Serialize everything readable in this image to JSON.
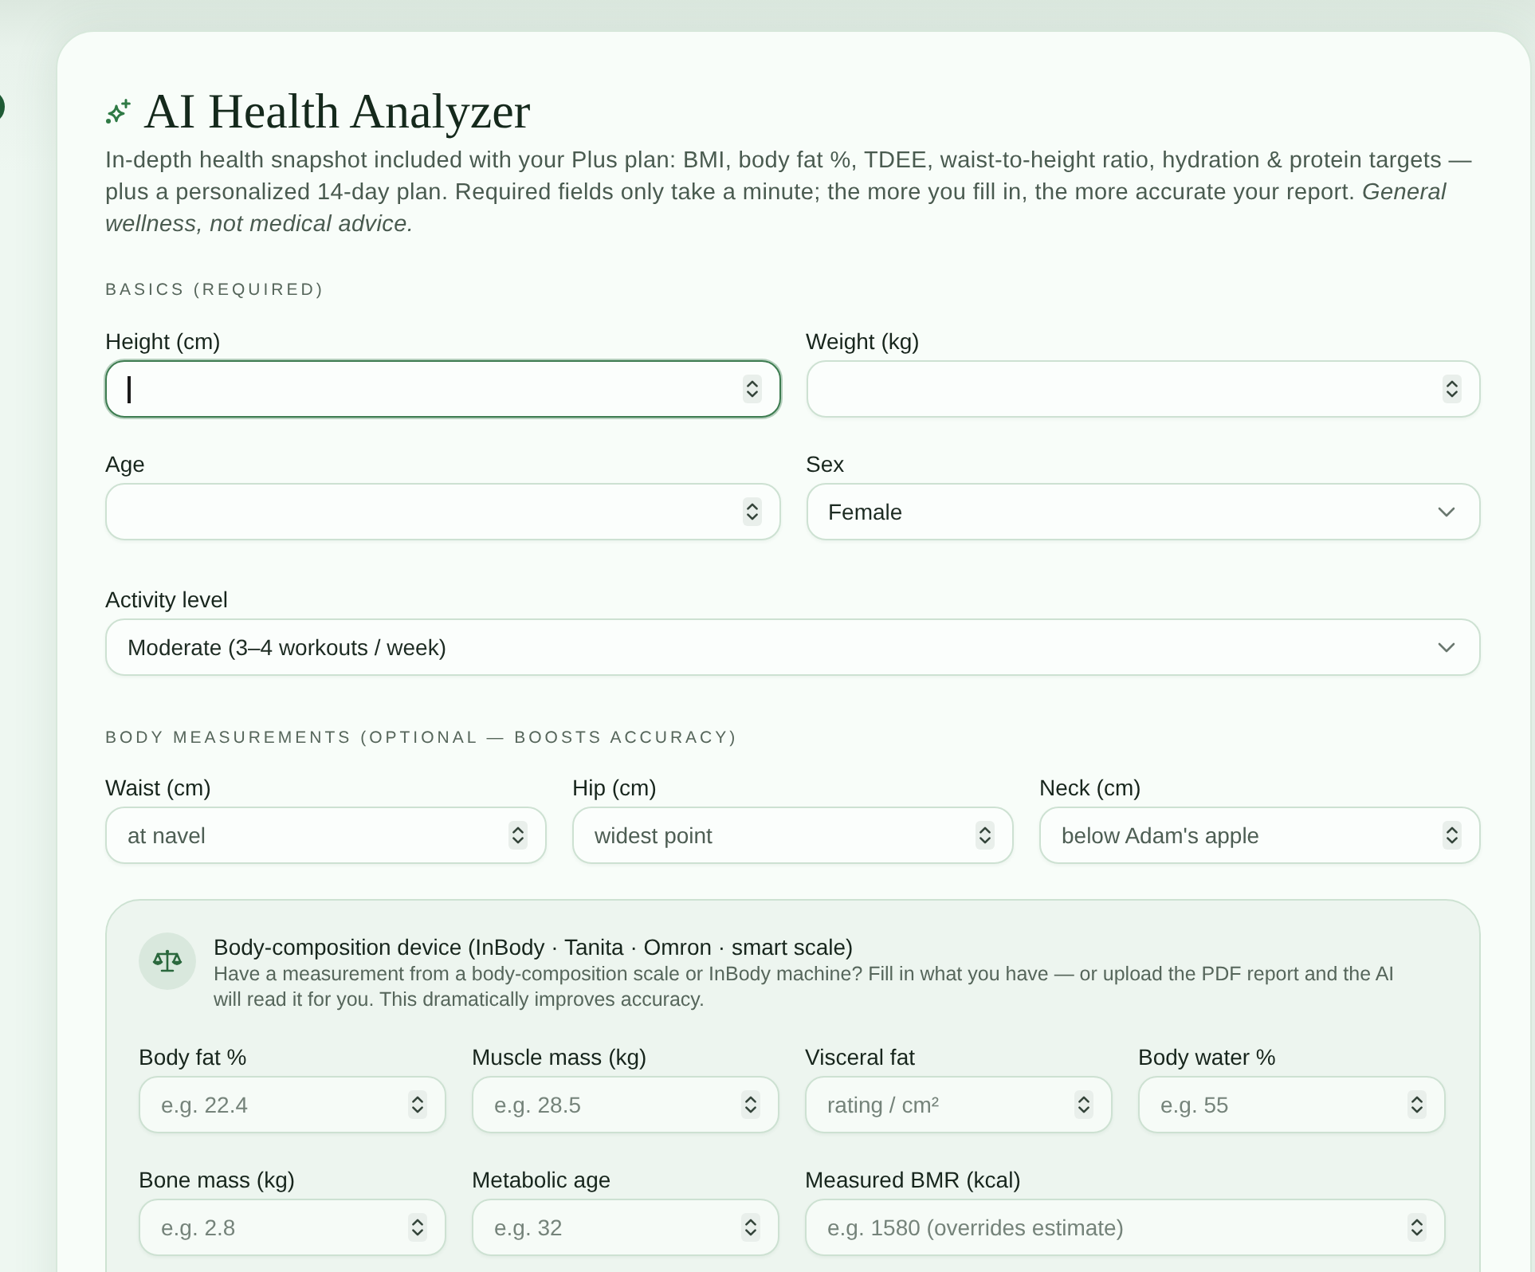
{
  "header": {
    "title": "AI Health Analyzer",
    "description": "In-depth health snapshot included with your Plus plan: BMI, body fat %, TDEE, waist-to-height ratio, hydration & protein targets — plus a personalized 14-day plan. Required fields only take a minute; the more you fill in, the more accurate your report. *General wellness, not medical advice.*"
  },
  "basics": {
    "heading": "BASICS (REQUIRED)",
    "rows": [
      {
        "fields": [
          {
            "label": "Height (cm)",
            "kind": "number",
            "focused": true
          },
          {
            "label": "Weight (kg)",
            "kind": "number",
            "focused": false
          }
        ]
      },
      {
        "fields": [
          {
            "label": "Age",
            "kind": "number",
            "focused": false
          },
          {
            "label": "Sex",
            "kind": "select",
            "value": "Female",
            "focused": false
          }
        ]
      },
      {
        "fields": [
          {
            "label": "Activity level",
            "kind": "select",
            "value": "Moderate (3–4 workouts / week)",
            "focused": false
          }
        ]
      }
    ]
  },
  "measurements": {
    "heading": "BODY MEASUREMENTS (OPTIONAL — BOOSTS ACCURACY)",
    "rows": [
      {
        "fields": [
          {
            "label": "Waist (cm)",
            "kind": "number",
            "placeholder": "at navel",
            "focused": false
          },
          {
            "label": "Hip (cm)",
            "kind": "number",
            "placeholder": "widest point",
            "focused": false
          },
          {
            "label": "Neck (cm)",
            "kind": "number",
            "placeholder": "below Adam's apple",
            "focused": false
          }
        ]
      }
    ]
  },
  "device": {
    "title": "Body-composition device (InBody · Tanita · Omron · smart scale)",
    "description": "Have a measurement from a body-composition scale or InBody machine? Fill in what you have — or upload the PDF report and the AI will read it for you. This dramatically improves accuracy.",
    "rows": [
      {
        "fields": [
          {
            "label": "Body fat %",
            "kind": "number",
            "placeholder": "e.g. 22.4",
            "focused": false
          },
          {
            "label": "Muscle mass (kg)",
            "kind": "number",
            "placeholder": "e.g. 28.5",
            "focused": false
          },
          {
            "label": "Visceral fat",
            "kind": "number",
            "placeholder": "rating / cm²",
            "focused": false
          },
          {
            "label": "Body water %",
            "kind": "number",
            "placeholder": "e.g. 55",
            "focused": false
          }
        ]
      },
      {
        "fields": [
          {
            "label": "Bone mass (kg)",
            "kind": "number",
            "placeholder": "e.g. 2.8",
            "focused": false
          },
          {
            "label": "Metabolic age",
            "kind": "number",
            "placeholder": "e.g. 32",
            "focused": false
          },
          {
            "label": "Measured BMR (kcal)",
            "kind": "number",
            "placeholder": "e.g. 1580 (overrides estimate)",
            "focused": false
          }
        ]
      }
    ]
  }
}
